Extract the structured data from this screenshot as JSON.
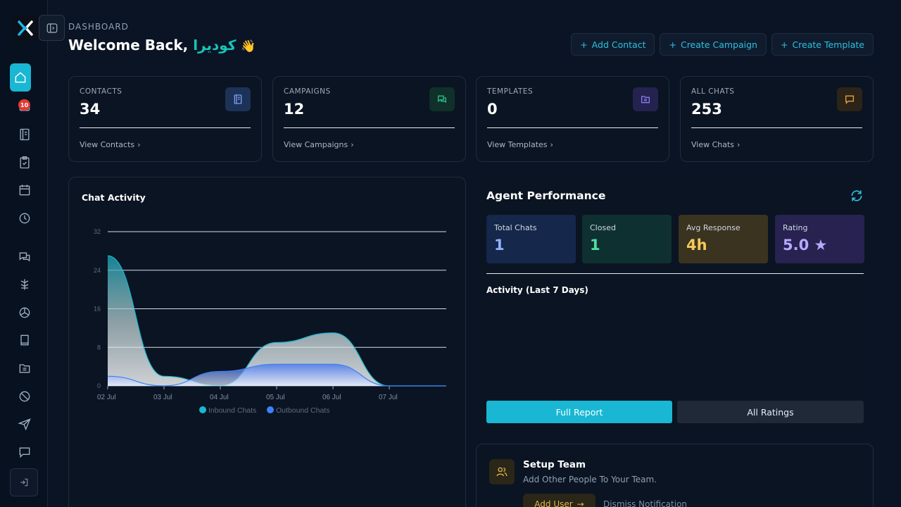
{
  "header": {
    "small": "DASHBOARD",
    "welcome": "Welcome Back,",
    "name": "كوديرا",
    "emoji": "👋"
  },
  "actions": [
    {
      "label": "Add Contact"
    },
    {
      "label": "Create Campaign"
    },
    {
      "label": "Create Template"
    }
  ],
  "sidebar": {
    "chat_badge": "10",
    "items": [
      {
        "icon": "home-icon"
      },
      {
        "icon": "inbox-icon"
      },
      {
        "icon": "contacts-book-icon"
      },
      {
        "icon": "clipboard-check-icon"
      },
      {
        "icon": "calendar-icon"
      },
      {
        "icon": "clock-icon"
      },
      {
        "icon": "chat-bubbles-icon"
      },
      {
        "icon": "flow-icon"
      },
      {
        "icon": "aperture-icon"
      },
      {
        "icon": "book-icon"
      },
      {
        "icon": "folder-icon"
      },
      {
        "icon": "block-icon"
      },
      {
        "icon": "send-icon"
      },
      {
        "icon": "message-icon"
      }
    ]
  },
  "stats": [
    {
      "label": "CONTACTS",
      "value": "34",
      "link": "View Contacts",
      "icon_color": "#7d9cf5",
      "icon_bg": "#1d3257",
      "icon": "contacts-book-icon"
    },
    {
      "label": "CAMPAIGNS",
      "value": "12",
      "link": "View Campaigns",
      "icon_color": "#27c08a",
      "icon_bg": "#10302a",
      "icon": "chat-bubbles-icon"
    },
    {
      "label": "TEMPLATES",
      "value": "0",
      "link": "View Templates",
      "icon_color": "#8b7df0",
      "icon_bg": "#24234f",
      "icon": "folder-icon"
    },
    {
      "label": "ALL CHATS",
      "value": "253",
      "link": "View Chats",
      "icon_color": "#e2a33b",
      "icon_bg": "#2c2418",
      "icon": "message-icon"
    }
  ],
  "chart": {
    "title": "Chat Activity"
  },
  "chart_data": {
    "type": "area",
    "x": [
      "02 Jul",
      "03 Jul",
      "04 Jul",
      "05 Jul",
      "06 Jul",
      "07 Jul"
    ],
    "yticks": [
      0,
      8,
      16,
      24,
      32
    ],
    "ylim": [
      0,
      32
    ],
    "legend": "bottom",
    "series": [
      {
        "name": "Inbound Chats",
        "color": "#19b7d3",
        "values": [
          27,
          2,
          0,
          9,
          11,
          0,
          0
        ]
      },
      {
        "name": "Outbound Chats",
        "color": "#3b82f6",
        "values": [
          2,
          0,
          3,
          4.5,
          4.5,
          0,
          0
        ]
      }
    ]
  },
  "agent": {
    "title": "Agent Performance",
    "kpis": [
      {
        "label": "Total Chats",
        "value": "1",
        "bg": "#15274a",
        "color": "#8fb3ff"
      },
      {
        "label": "Closed",
        "value": "1",
        "bg": "#0f3030",
        "color": "#4ee0a2"
      },
      {
        "label": "Avg Response",
        "value": "4h",
        "bg": "#3a3320",
        "color": "#f5c85a"
      },
      {
        "label": "Rating",
        "value": "5.0 ★",
        "bg": "#272250",
        "color": "#b9a8ff"
      }
    ],
    "activity": "Activity (Last 7 Days)",
    "full_report": "Full Report",
    "all_ratings": "All Ratings"
  },
  "setup": {
    "title": "Setup Team",
    "subtitle": "Add Other People To Your Team.",
    "add_user": "Add User",
    "dismiss": "Dismiss Notification"
  }
}
